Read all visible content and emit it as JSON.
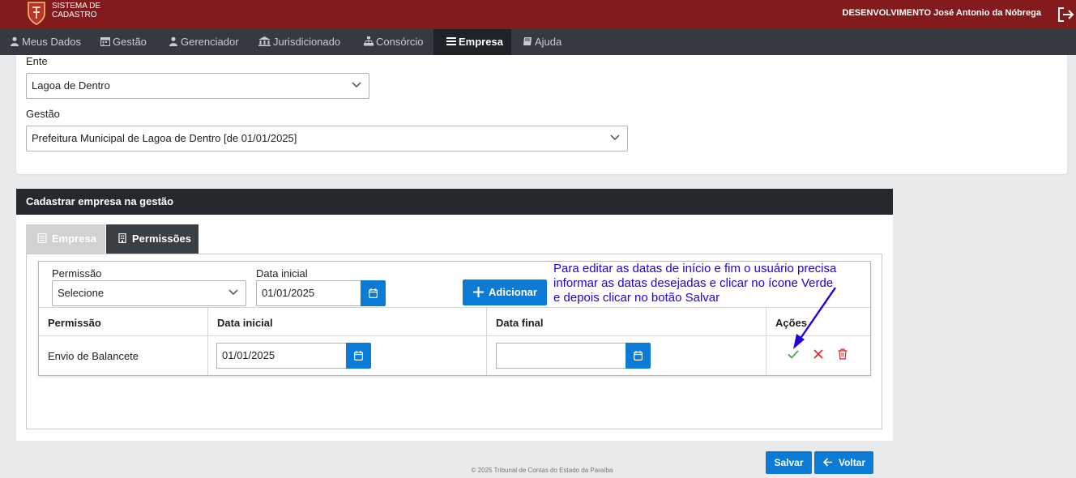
{
  "header": {
    "system_title_line1": "SISTEMA DE",
    "system_title_line2": "CADASTRO",
    "user": "DESENVOLVIMENTO José Antonio da Nóbrega",
    "brand_color": "#831a1c"
  },
  "nav": {
    "items": [
      {
        "label": "Meus Dados",
        "icon": "user-icon"
      },
      {
        "label": "Gestão",
        "icon": "calendar-icon"
      },
      {
        "label": "Gerenciador",
        "icon": "user-icon"
      },
      {
        "label": "Jurisdicionado",
        "icon": "institution-icon"
      },
      {
        "label": "Consórcio",
        "icon": "sitemap-icon"
      },
      {
        "label": "Empresa",
        "icon": "list-icon",
        "active": true
      },
      {
        "label": "Ajuda",
        "icon": "book-icon"
      }
    ]
  },
  "filters": {
    "ente_label": "Ente",
    "ente_value": "Lagoa de Dentro",
    "gestao_label": "Gestão",
    "gestao_value": "Prefeitura Municipal de Lagoa de Dentro [de 01/01/2025]"
  },
  "card": {
    "title": "Cadastrar empresa na gestão",
    "tabs": [
      {
        "label": "Empresa",
        "icon": "document-icon",
        "active": false
      },
      {
        "label": "Permissões",
        "icon": "building-icon",
        "active": true
      }
    ]
  },
  "add_form": {
    "permissao_label": "Permissão",
    "permissao_value": "Selecione",
    "data_label": "Data inicial",
    "data_value": "01/01/2025",
    "add_button": "Adicionar"
  },
  "table": {
    "headers": [
      "Permissão",
      "Data inicial",
      "Data final",
      "Ações"
    ],
    "rows": [
      {
        "permissao": "Envio de Balancete",
        "data_inicial": "01/01/2025",
        "data_final": ""
      }
    ]
  },
  "buttons": {
    "save": "Salvar",
    "back": "Voltar"
  },
  "annotation": {
    "line1": "Para editar as datas de início e fim o usuário precisa",
    "line2": "informar as datas desejadas e clicar no ícone Verde",
    "line3": "e depois clicar no botão Salvar",
    "color": "#2200dd"
  },
  "footer": "© 2025 Tribunal de Contas do Estado da Paraíba",
  "colors": {
    "primary": "#0c7bd6",
    "success": "#3a9a3a",
    "danger": "#d9262c",
    "nav_bg": "#343a40"
  }
}
